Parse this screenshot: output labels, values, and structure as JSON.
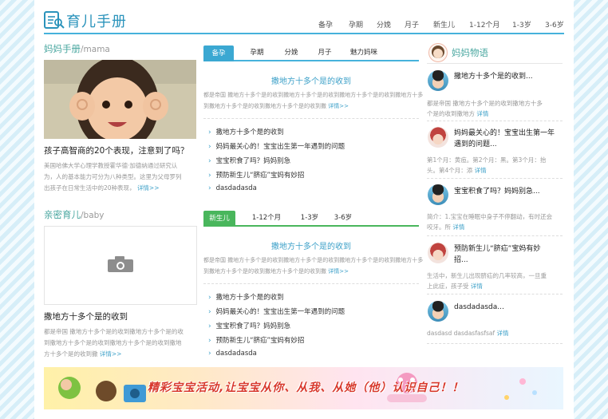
{
  "site": {
    "logo_text": "育儿手册"
  },
  "topnav": [
    "备孕",
    "孕期",
    "分娩",
    "月子",
    "新生儿",
    "1-12个月",
    "1-3岁",
    "3-6岁"
  ],
  "mama": {
    "title": "妈妈手册",
    "sub": "/mama",
    "headline": "孩子高智商的20个表现，注意到了吗？",
    "lines": [
      "美国哈佛大学心理学教授霍华德·加德纳通过研究认",
      "为，人的基本能力可分为八种类型。这里为父母罗列",
      "出孩子在日常生活中的20种表现，"
    ],
    "more": "详情>>"
  },
  "baby": {
    "title": "亲密育儿",
    "sub": "/baby",
    "headline": "撒地方十多个是的收到",
    "lines": [
      "都是帝国 撒地方十多个是的收到撒地方十多个是的收",
      "到撒地方十多个是的收到撒地方十多个是的收到撒地",
      "方十多个是的收到撒"
    ],
    "more": "详情>>"
  },
  "mid1": {
    "tabs": [
      "备孕",
      "孕期",
      "分娩",
      "月子",
      "魅力妈咪"
    ],
    "feature_title": "撒地方十多个是的收到",
    "feature_lines": [
      "都是帝国 撒地方十多个是的收到撒地方十多个是的收到撒地方十多个是的收到撒地方十多个是的收",
      "到撒地方十多个是的收到撒地方十多个是的收到撒"
    ],
    "more": "详情>>",
    "list": [
      "撒地方十多个是的收到",
      "妈妈最关心的！宝宝出生第一年遇到的问题",
      "宝宝积食了吗？妈妈别急",
      "预防新生儿“脐疝”宝妈有妙招",
      "dasdadasda"
    ]
  },
  "mid2": {
    "tabs": [
      "新生儿",
      "1-12个月",
      "1-3岁",
      "3-6岁"
    ],
    "feature_title": "撒地方十多个是的收到",
    "feature_lines": [
      "都是帝国 撒地方十多个是的收到撒地方十多个是的收到撒地方十多个是的收到撒地方十多个是的收",
      "到撒地方十多个是的收到撒地方十多个是的收到撒"
    ],
    "more": "详情>>",
    "list": [
      "撒地方十多个是的收到",
      "妈妈最关心的！宝宝出生第一年遇到的问题",
      "宝宝积食了吗？妈妈别急",
      "预防新生儿“脐疝”宝妈有妙招",
      "dasdadasda"
    ]
  },
  "right": {
    "title": "妈妈物语",
    "items": [
      {
        "title": [
          "撒地方十多个是的收到..."
        ],
        "small": [
          "都是帝国 撒地方十多个是的收到撒地方十多",
          "个是的收到撒地方"
        ],
        "more": "详情"
      },
      {
        "title": [
          "妈妈最关心的！宝宝出生第一年",
          "遇到的问题..."
        ],
        "small": [
          "第1个月：黄疸。第2个月：黑。第3个月：抬",
          "头。第4个月：添"
        ],
        "more": "详情"
      },
      {
        "title": [
          "宝宝积食了吗？妈妈别急..."
        ],
        "small": [
          "简介：1.宝宝在睡眠中身子不停翻动，有时还会",
          "咬牙。所"
        ],
        "more": "详情"
      },
      {
        "title": [
          "预防新生儿“脐疝”宝妈有妙",
          "招..."
        ],
        "small": [
          "生活中，新生儿出现脐疝的几率较高，一旦重",
          "上此症，孩子受"
        ],
        "more": "详情"
      },
      {
        "title": [
          "dasdadasda..."
        ],
        "small": [
          "dasdasd dasdasfasfsaf"
        ],
        "more": "详情"
      }
    ]
  },
  "banner": {
    "text": "精彩宝宝活动,让宝宝从你、从我、从她（他）认识自己！！"
  }
}
